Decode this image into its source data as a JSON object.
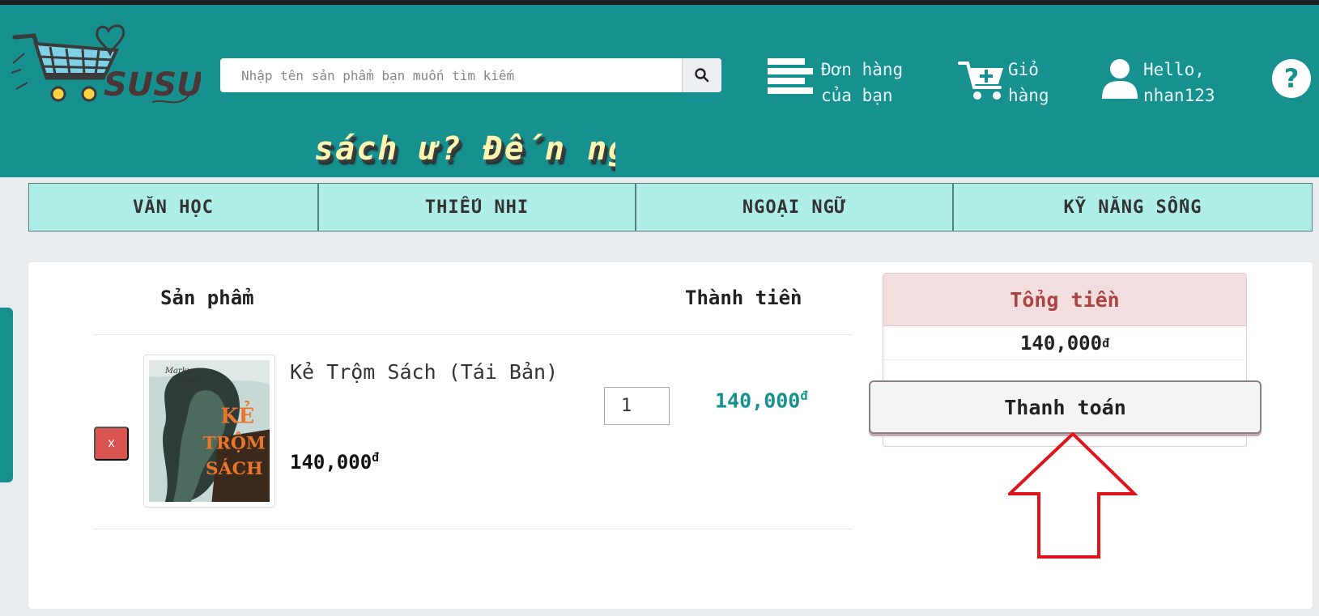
{
  "header": {
    "search": {
      "placeholder": "Nhập tên sản phẩm bạn muốn tìm kiếm",
      "button_icon": "search-icon"
    },
    "orders": {
      "line1": "Đơn hàng",
      "line2": "của bạn",
      "icon": "list-icon"
    },
    "cart": {
      "line1": "Giỏ",
      "line2": "hàng",
      "icon": "cart-icon"
    },
    "user": {
      "line1": "Hello,",
      "line2": "nhan123",
      "icon": "user-icon"
    },
    "help_icon": "help-icon",
    "marquee": "sách ư? Đến ngay",
    "logo": {
      "text": "SUSU"
    }
  },
  "nav": {
    "tabs": [
      {
        "label": "VĂN HỌC"
      },
      {
        "label": "THIẾU NHI"
      },
      {
        "label": "NGOẠI NGỮ"
      },
      {
        "label": "KỸ NĂNG SỐNG"
      }
    ]
  },
  "cart": {
    "col_product": "Sản phẩm",
    "col_total": "Thành tiền",
    "items": [
      {
        "remove_label": "x",
        "name": "Kẻ Trộm Sách (Tái Bản)",
        "price": "140,000",
        "currency": "đ",
        "quantity": "1",
        "subtotal": "140,000",
        "cover": {
          "author": "Markus Zusak",
          "title_line1": "KẺ",
          "title_line2": "TRỘM",
          "title_line3": "SÁCH"
        }
      }
    ]
  },
  "summary": {
    "title": "Tổng tiền",
    "total": "140,000",
    "currency": "đ",
    "pay_label": "Thanh toán"
  },
  "colors": {
    "header_bg": "#179090",
    "nav_bg": "#aeeee6",
    "remove_bg": "#d9534f",
    "summary_head_bg": "#f2dede",
    "summary_head_text": "#a94442",
    "subtotal_text": "#179090",
    "annotation_arrow": "#e0141c"
  }
}
